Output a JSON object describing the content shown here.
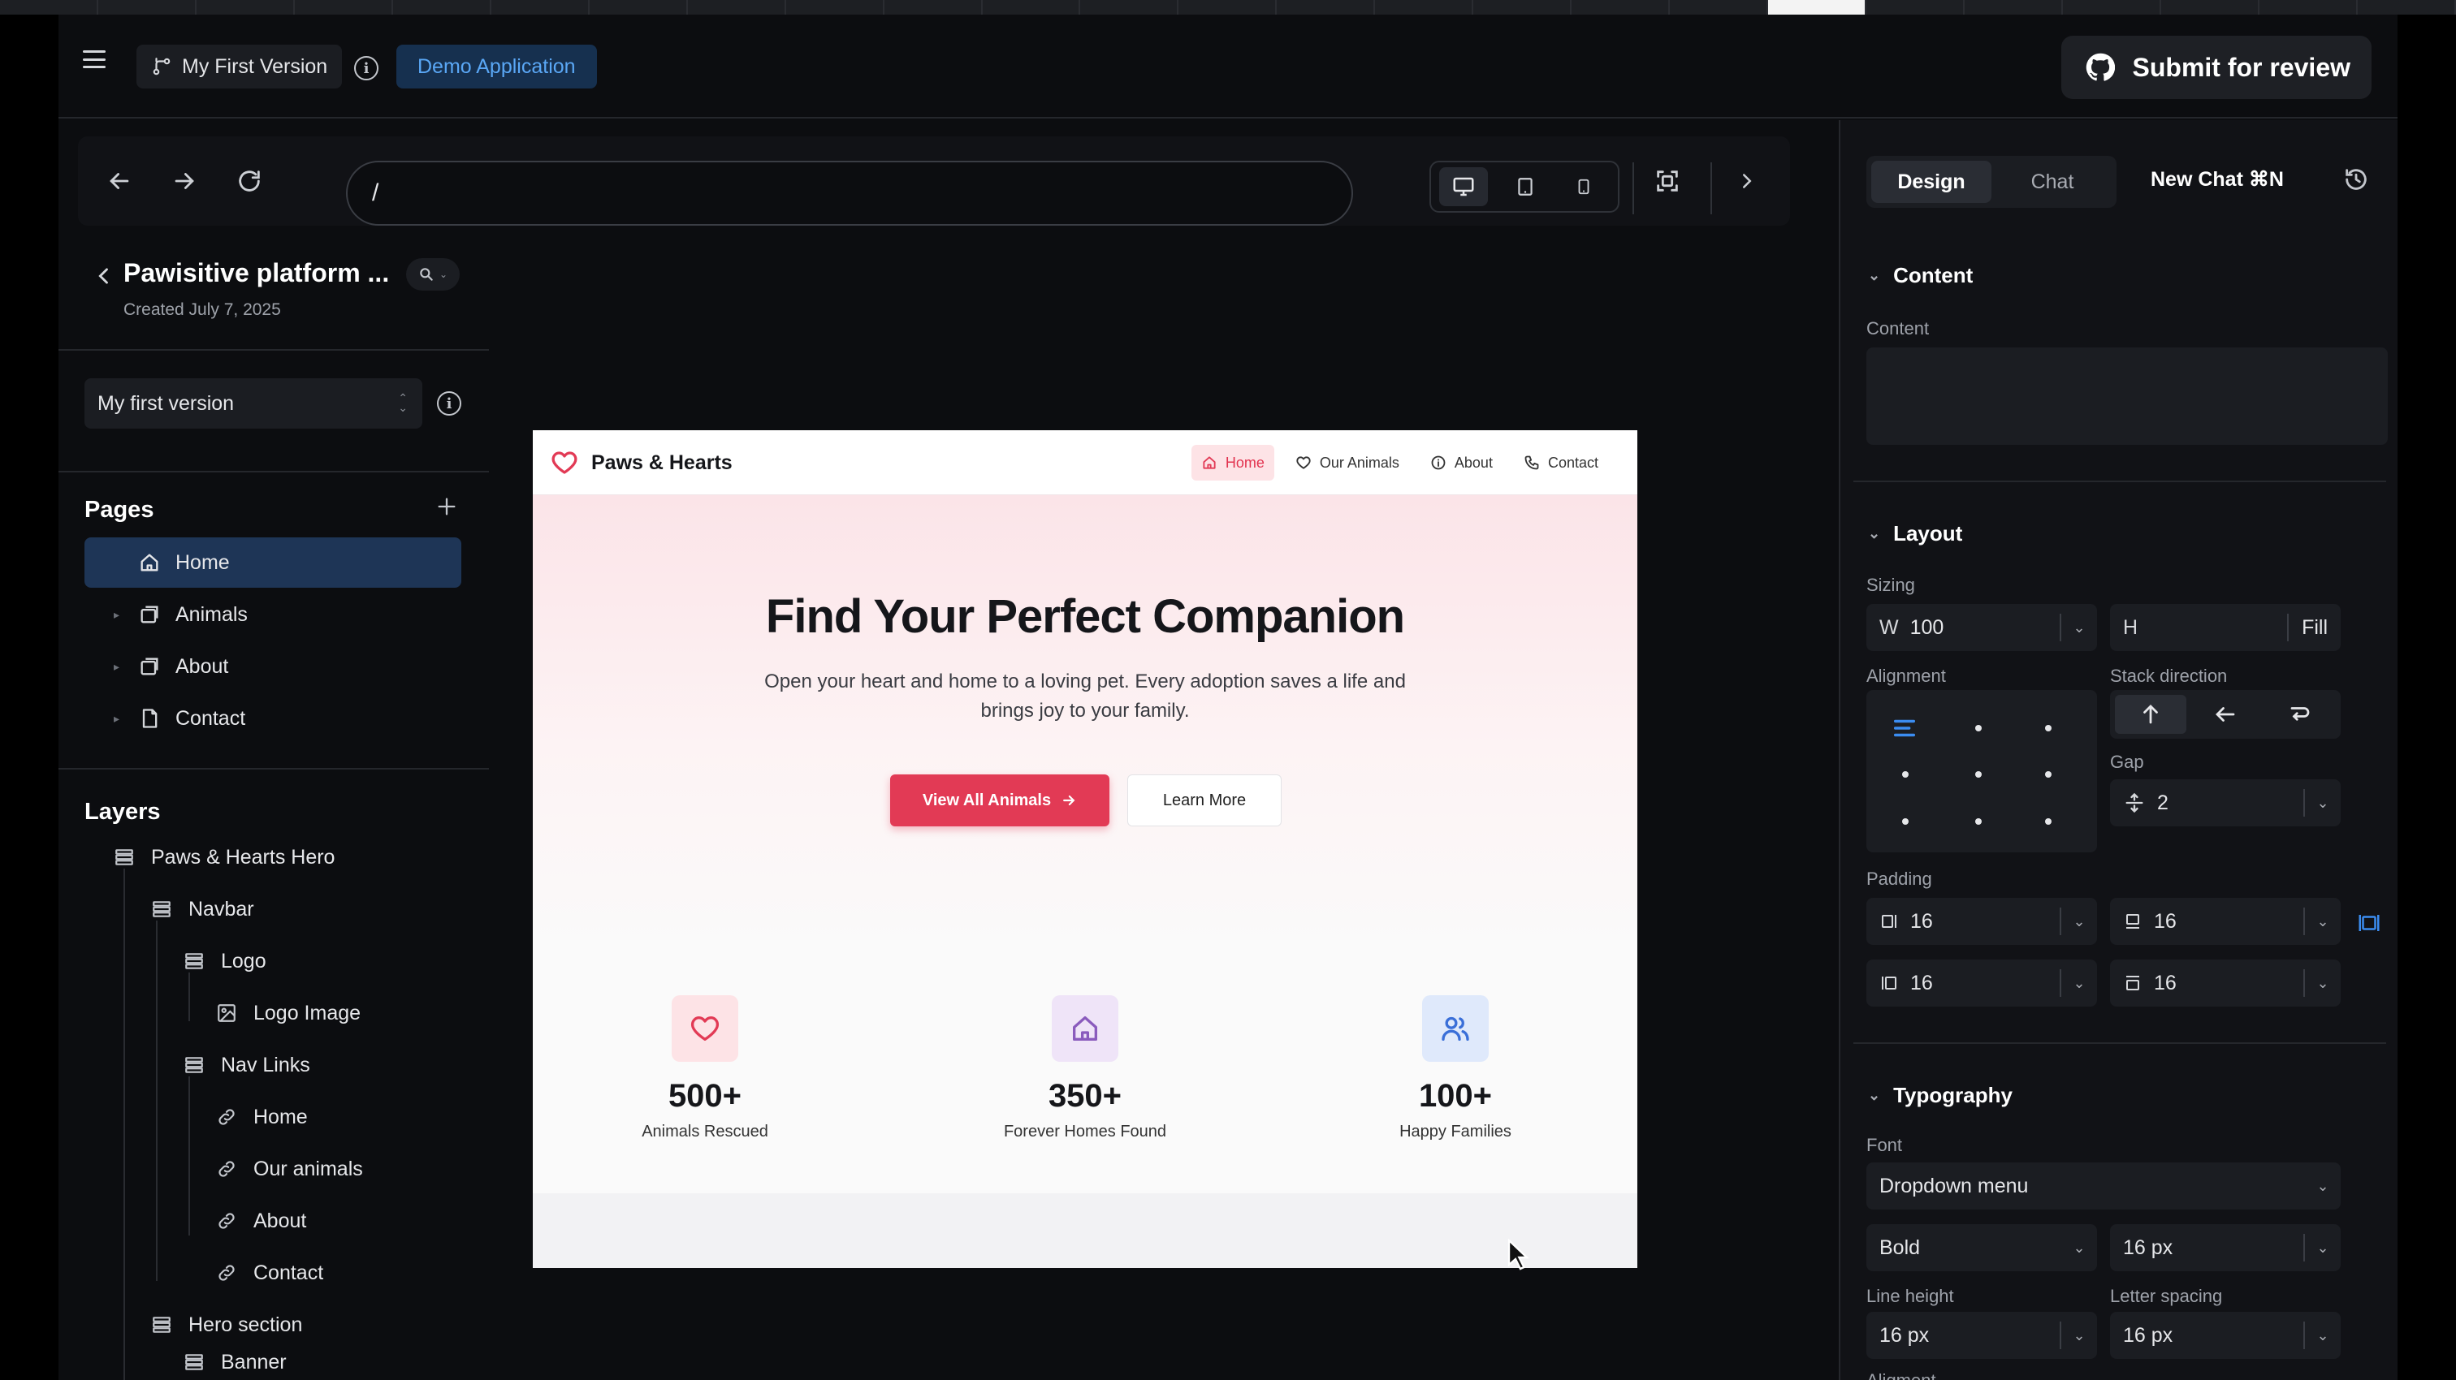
{
  "topbar": {
    "version_label": "My First Version",
    "badge": "Demo Application",
    "submit_label": "Submit for review"
  },
  "toolbar": {
    "url_value": "/"
  },
  "sidebar": {
    "project_title": "Pawisitive platform ...",
    "created": "Created July 7, 2025",
    "version_select": "My first version",
    "pages_heading": "Pages",
    "pages": [
      {
        "label": "Home",
        "icon": "home-icon",
        "selected": true
      },
      {
        "label": "Animals",
        "icon": "copy-icon"
      },
      {
        "label": "About",
        "icon": "copy-icon"
      },
      {
        "label": "Contact",
        "icon": "file-icon"
      }
    ],
    "layers_heading": "Layers",
    "layers": [
      {
        "label": "Paws & Hearts Hero",
        "icon": "stack-icon",
        "depth": 0
      },
      {
        "label": "Navbar",
        "icon": "stack-icon",
        "depth": 1
      },
      {
        "label": "Logo",
        "icon": "stack-icon",
        "depth": 2
      },
      {
        "label": "Logo Image",
        "icon": "image-icon",
        "depth": 3
      },
      {
        "label": "Nav Links",
        "icon": "stack-icon",
        "depth": 2
      },
      {
        "label": "Home",
        "icon": "link-icon",
        "depth": 3
      },
      {
        "label": "Our animals",
        "icon": "link-icon",
        "depth": 3
      },
      {
        "label": "About",
        "icon": "link-icon",
        "depth": 3
      },
      {
        "label": "Contact",
        "icon": "link-icon",
        "depth": 3
      },
      {
        "label": "Hero section",
        "icon": "stack-icon",
        "depth": 1
      },
      {
        "label": "Banner",
        "icon": "stack-icon",
        "depth": 2
      }
    ]
  },
  "preview": {
    "brand": "Paws & Hearts",
    "nav": [
      {
        "label": "Home",
        "icon": "home-icon",
        "active": true
      },
      {
        "label": "Our Animals",
        "icon": "heart-icon"
      },
      {
        "label": "About",
        "icon": "info-icon"
      },
      {
        "label": "Contact",
        "icon": "phone-icon"
      }
    ],
    "hero_title": "Find Your Perfect Companion",
    "hero_subtitle": "Open your heart and home to a loving pet. Every adoption saves a life and brings joy to your family.",
    "primary_cta": "View All Animals",
    "secondary_cta": "Learn More",
    "stats": [
      {
        "value": "500+",
        "label": "Animals Rescued",
        "icon": "heart-icon",
        "bg": "#fde3e6",
        "color": "#e23a55"
      },
      {
        "value": "350+",
        "label": "Forever Homes Found",
        "icon": "home-icon",
        "bg": "#efe4f8",
        "color": "#8a5bbd"
      },
      {
        "value": "100+",
        "label": "Happy Families",
        "icon": "users-icon",
        "bg": "#dfe9fb",
        "color": "#3a6fd8"
      }
    ],
    "colors": {
      "accent": "#e23a55"
    }
  },
  "panel": {
    "tabs": [
      "Design",
      "Chat"
    ],
    "active_tab": "Design",
    "new_chat": "New Chat ⌘N",
    "content": {
      "heading": "Content",
      "label": "Content",
      "value": ""
    },
    "layout": {
      "heading": "Layout",
      "sizing_label": "Sizing",
      "width_prefix": "W",
      "width": "100",
      "height_prefix": "H",
      "height": "",
      "height_mode": "Fill",
      "alignment_label": "Alignment",
      "stack_direction_label": "Stack direction",
      "gap_label": "Gap",
      "gap": "2",
      "padding_label": "Padding",
      "padding_left": "16",
      "padding_bottom": "16",
      "padding_right": "16",
      "padding_top": "16"
    },
    "typography": {
      "heading": "Typography",
      "font_label": "Font",
      "font": "Dropdown menu",
      "weight": "Bold",
      "size": "16 px",
      "line_height_label": "Line height",
      "line_height": "16 px",
      "letter_spacing_label": "Letter spacing",
      "letter_spacing": "16 px",
      "alignment_label": "Aligment"
    }
  }
}
